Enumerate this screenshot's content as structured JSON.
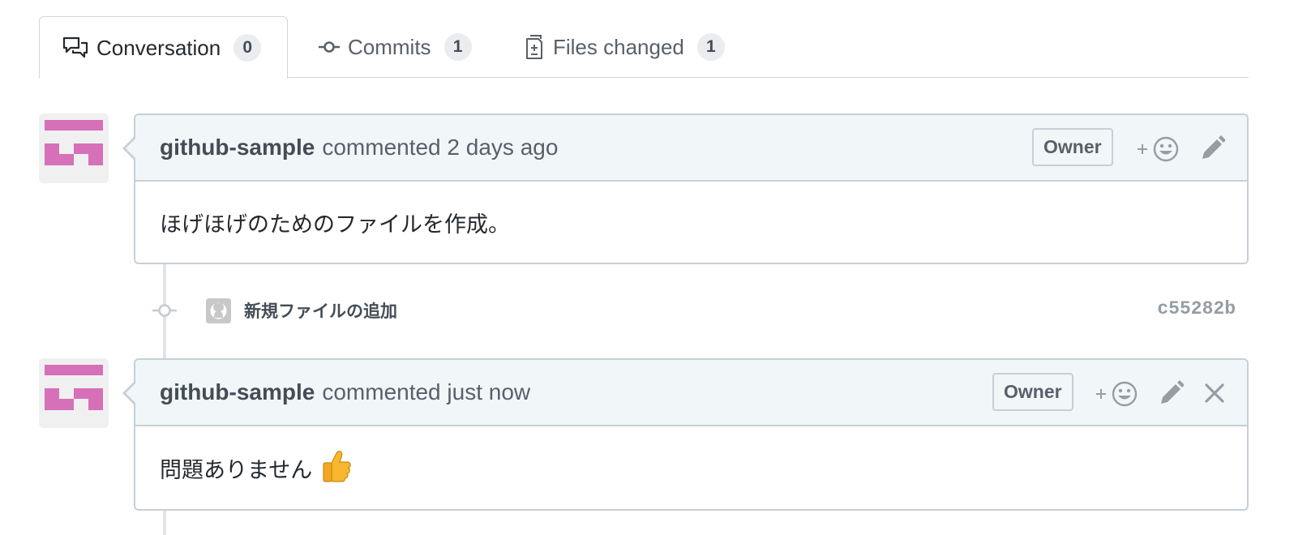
{
  "tabs": [
    {
      "label": "Conversation",
      "count": "0",
      "icon": "comment-discussion-icon",
      "selected": true
    },
    {
      "label": "Commits",
      "count": "1",
      "icon": "git-commit-icon",
      "selected": false
    },
    {
      "label": "Files changed",
      "count": "1",
      "icon": "diff-icon",
      "selected": false
    }
  ],
  "comments": [
    {
      "author": "github-sample",
      "meta": "commented 2 days ago",
      "badge": "Owner",
      "body": "ほげほげのためのファイルを作成。",
      "actions": [
        "add-reaction-icon",
        "edit-pencil-icon"
      ]
    },
    {
      "author": "github-sample",
      "meta": "commented just now",
      "badge": "Owner",
      "body": "問題ありません",
      "body_emoji": "thumbs-up",
      "actions": [
        "add-reaction-icon",
        "edit-pencil-icon",
        "close-icon"
      ]
    }
  ],
  "commit": {
    "message": "新規ファイルの追加",
    "sha": "c55282b"
  },
  "colors": {
    "avatar_pink": "#d670b8",
    "header_bg": "#f1f6f9",
    "border": "#c6d0d7",
    "counter_bg": "#eaecef"
  }
}
